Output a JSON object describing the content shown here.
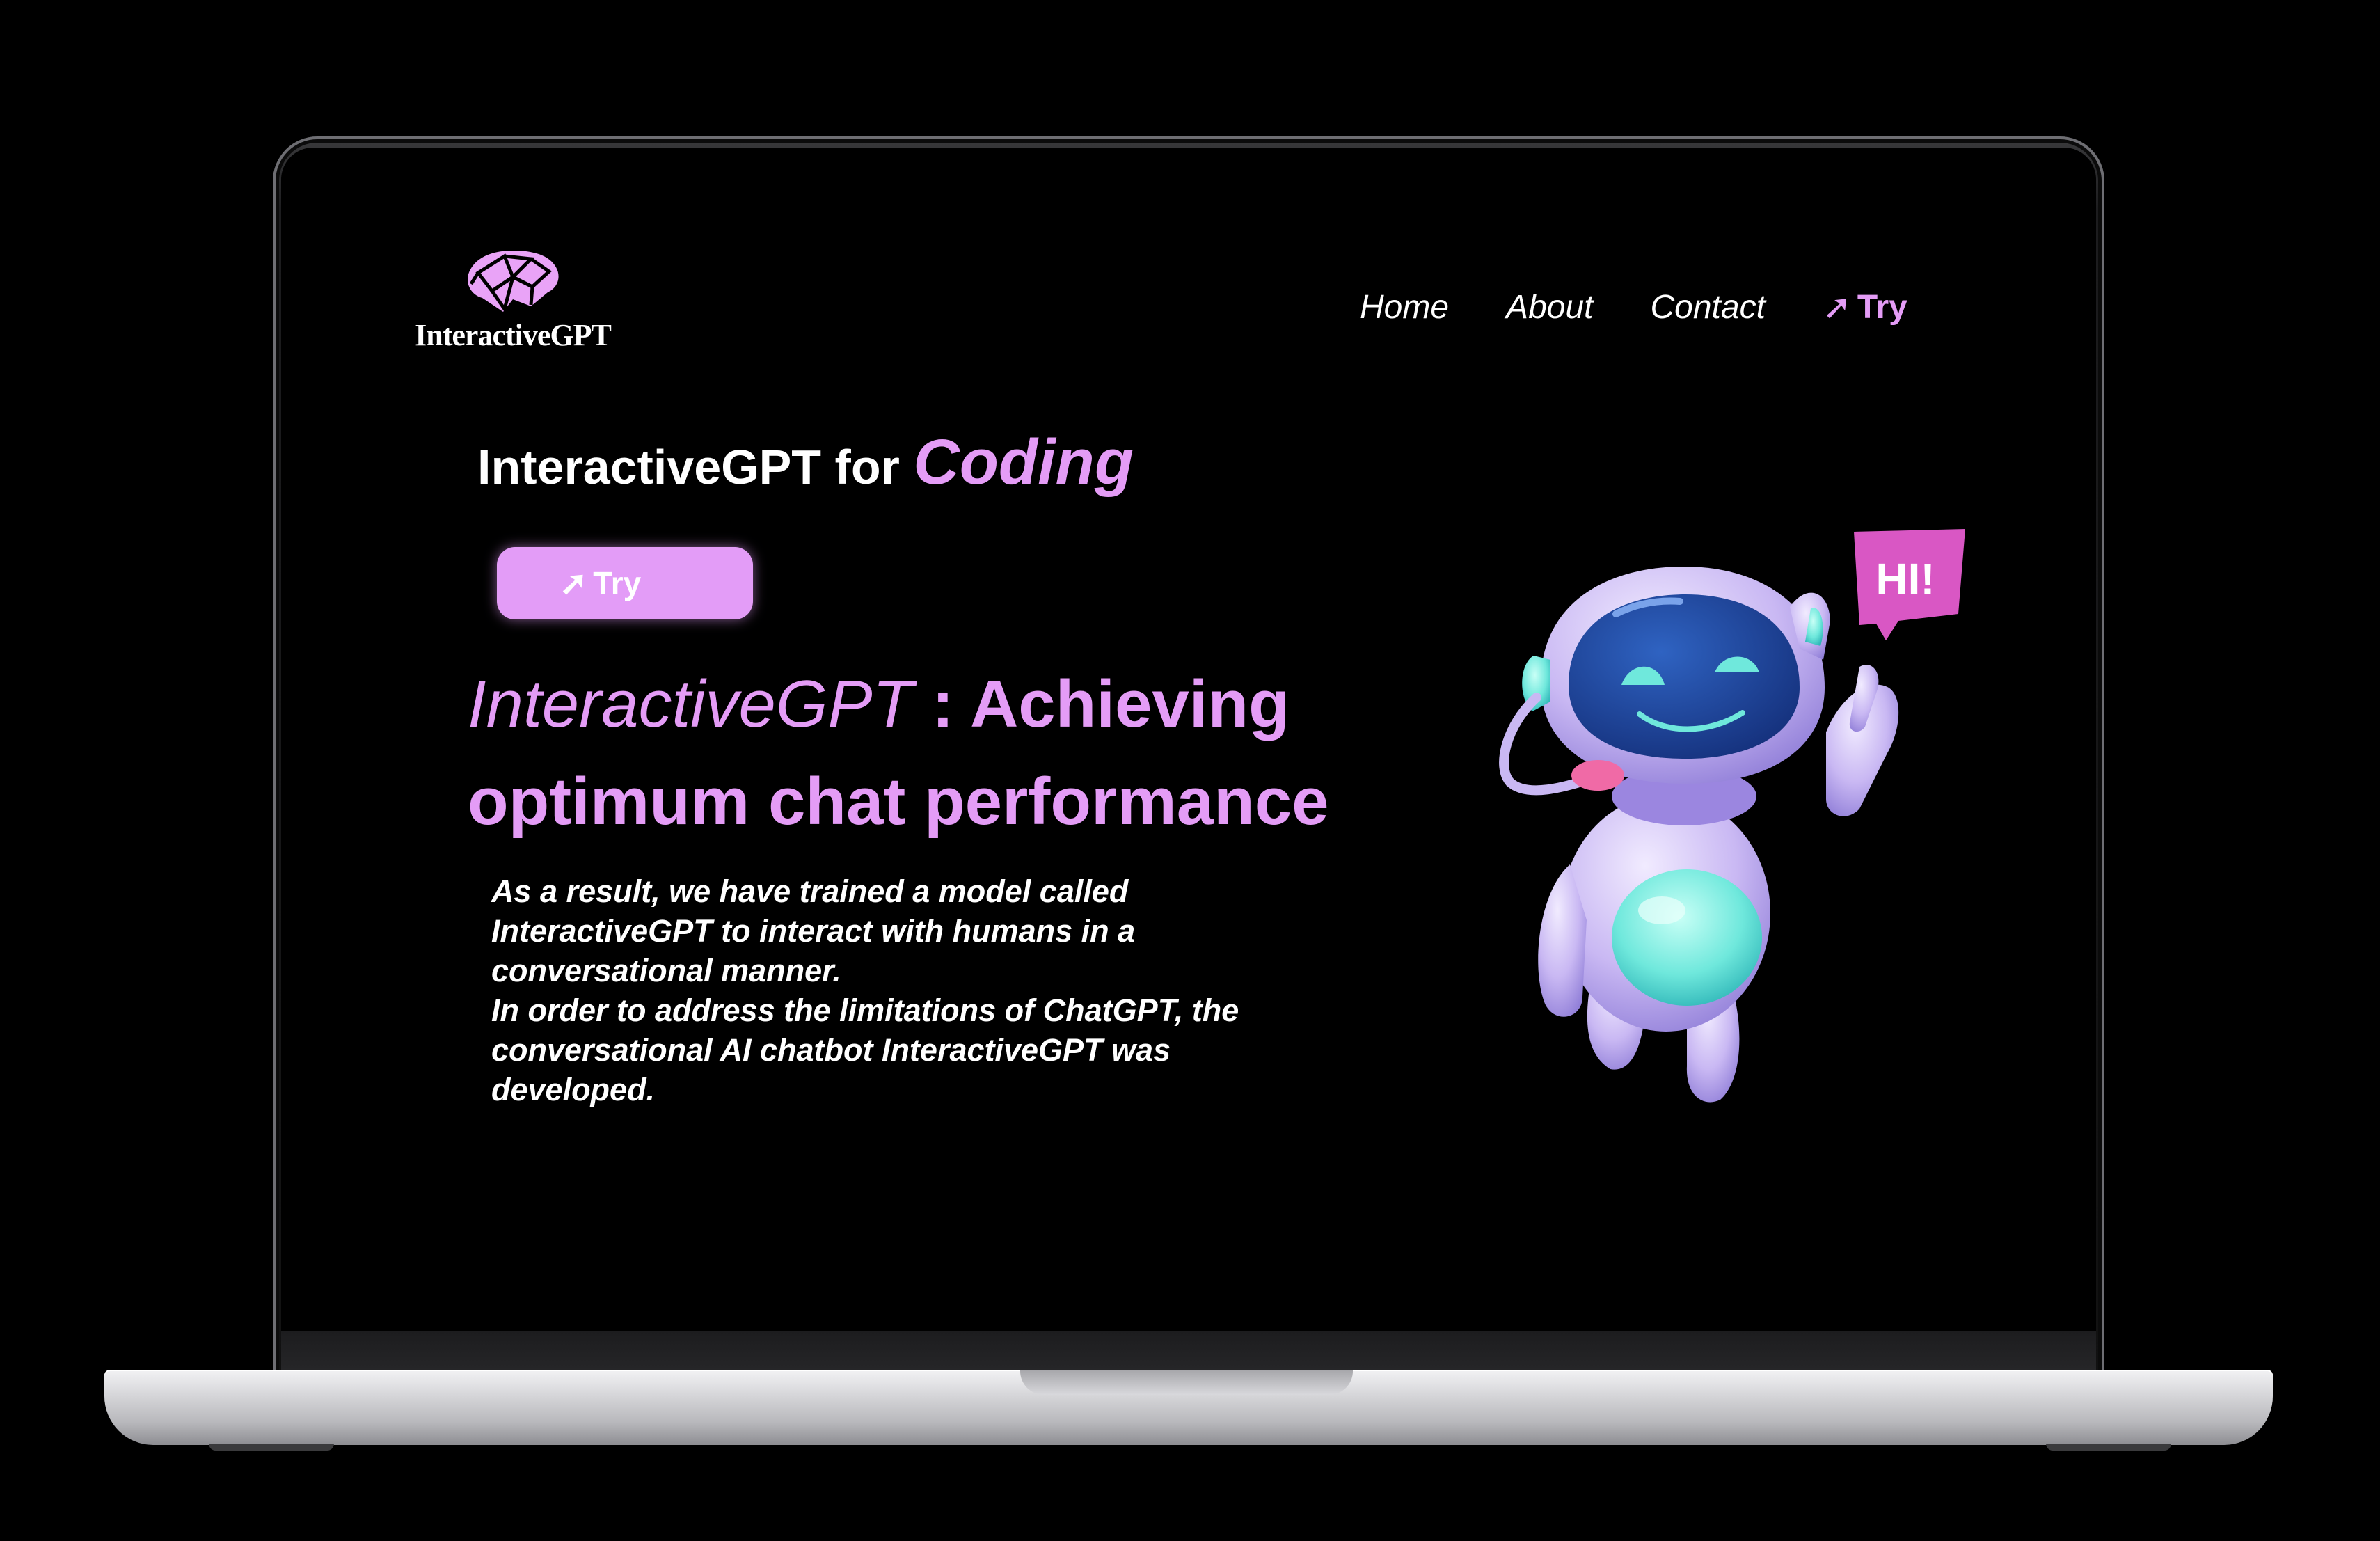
{
  "logo": {
    "text": "InteractiveGPT"
  },
  "nav": {
    "items": [
      "Home",
      "About",
      "Contact"
    ],
    "try_label": "Try"
  },
  "headline": {
    "prefix": "InteractiveGPT for ",
    "accent": "Coding"
  },
  "try_button": {
    "label": "Try"
  },
  "hero": {
    "brand": "InteractiveGPT",
    "separator": " : ",
    "line1_rest": "Achieving",
    "line2": "optimum chat performance"
  },
  "body": {
    "paragraph1": "As a result, we have trained a model called InteractiveGPT to interact with humans in a conversational manner.",
    "paragraph2": "In order to address the limitations of ChatGPT, the conversational AI chatbot InteractiveGPT was developed."
  },
  "speech_bubble": {
    "text": "HI!"
  },
  "icons": {
    "logo": "brain-network-icon",
    "try": "arrow-up-right-icon"
  },
  "colors": {
    "accent": "#e49cf6",
    "button": "#e39cf7",
    "background": "#000000",
    "bubble": "#d957c4",
    "robot_body": "#c9b8f3",
    "robot_visor": "#1f4da3",
    "robot_glow": "#6fe8dc"
  }
}
